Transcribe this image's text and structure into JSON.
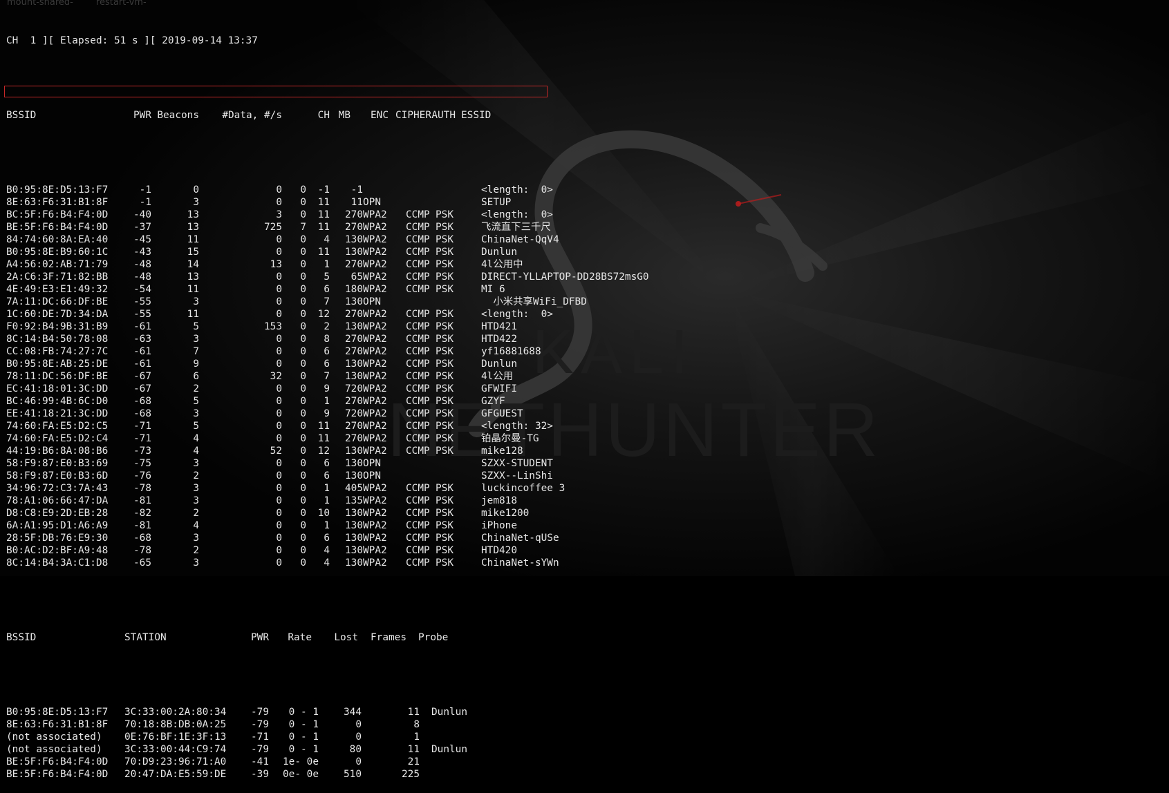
{
  "ghost_text": "mount-shared-        restart-vm-",
  "status_line": "CH  1 ][ Elapsed: 51 s ][ 2019-09-14 13:37",
  "ap_headers": [
    "BSSID",
    "PWR",
    "Beacons",
    "#Data, #/s",
    "CH",
    "MB",
    "ENC",
    "CIPHER",
    "AUTH",
    "ESSID"
  ],
  "ap_rows": [
    [
      "B0:95:8E:D5:13:F7",
      "-1",
      "0",
      "0",
      "0",
      "-1",
      "-1",
      "",
      "",
      "",
      "<length:  0>"
    ],
    [
      "8E:63:F6:31:B1:8F",
      "-1",
      "3",
      "0",
      "0",
      "11",
      "11",
      "OPN",
      "",
      "",
      "SETUP"
    ],
    [
      "BC:5F:F6:B4:F4:0D",
      "-40",
      "13",
      "3",
      "0",
      "11",
      "270",
      "WPA2",
      "CCMP",
      "PSK",
      "<length:  0>"
    ],
    [
      "BE:5F:F6:B4:F4:0D",
      "-37",
      "13",
      "725",
      "7",
      "11",
      "270",
      "WPA2",
      "CCMP",
      "PSK",
      "飞流直下三千尺"
    ],
    [
      "84:74:60:8A:EA:40",
      "-45",
      "11",
      "0",
      "0",
      "4",
      "130",
      "WPA2",
      "CCMP",
      "PSK",
      "ChinaNet-QqV4"
    ],
    [
      "B0:95:8E:B9:60:1C",
      "-43",
      "15",
      "0",
      "0",
      "11",
      "130",
      "WPA2",
      "CCMP",
      "PSK",
      "Dunlun"
    ],
    [
      "A4:56:02:AB:71:79",
      "-48",
      "14",
      "13",
      "0",
      "1",
      "270",
      "WPA2",
      "CCMP",
      "PSK",
      "4l公用中"
    ],
    [
      "2A:C6:3F:71:82:BB",
      "-48",
      "13",
      "0",
      "0",
      "5",
      "65",
      "WPA2",
      "CCMP",
      "PSK",
      "DIRECT-YLLAPTOP-DD28BS72msG0"
    ],
    [
      "4E:49:E3:E1:49:32",
      "-54",
      "11",
      "0",
      "0",
      "6",
      "180",
      "WPA2",
      "CCMP",
      "PSK",
      "MI 6"
    ],
    [
      "7A:11:DC:66:DF:BE",
      "-55",
      "3",
      "0",
      "0",
      "7",
      "130",
      "OPN",
      "",
      "",
      "  小米共享WiFi_DFBD"
    ],
    [
      "1C:60:DE:7D:34:DA",
      "-55",
      "11",
      "0",
      "0",
      "12",
      "270",
      "WPA2",
      "CCMP",
      "PSK",
      "<length:  0>"
    ],
    [
      "F0:92:B4:9B:31:B9",
      "-61",
      "5",
      "153",
      "0",
      "2",
      "130",
      "WPA2",
      "CCMP",
      "PSK",
      "HTD421"
    ],
    [
      "8C:14:B4:50:78:08",
      "-63",
      "3",
      "0",
      "0",
      "8",
      "270",
      "WPA2",
      "CCMP",
      "PSK",
      "HTD422"
    ],
    [
      "CC:08:FB:74:27:7C",
      "-61",
      "7",
      "0",
      "0",
      "6",
      "270",
      "WPA2",
      "CCMP",
      "PSK",
      "yf16881688"
    ],
    [
      "B0:95:8E:AB:25:DE",
      "-61",
      "9",
      "0",
      "0",
      "6",
      "130",
      "WPA2",
      "CCMP",
      "PSK",
      "Dunlun"
    ],
    [
      "78:11:DC:56:DF:BE",
      "-67",
      "6",
      "32",
      "0",
      "7",
      "130",
      "WPA2",
      "CCMP",
      "PSK",
      "4l公用"
    ],
    [
      "EC:41:18:01:3C:DD",
      "-67",
      "2",
      "0",
      "0",
      "9",
      "720",
      "WPA2",
      "CCMP",
      "PSK",
      "GFWIFI"
    ],
    [
      "BC:46:99:4B:6C:D0",
      "-68",
      "5",
      "0",
      "0",
      "1",
      "270",
      "WPA2",
      "CCMP",
      "PSK",
      "GZYF"
    ],
    [
      "EE:41:18:21:3C:DD",
      "-68",
      "3",
      "0",
      "0",
      "9",
      "720",
      "WPA2",
      "CCMP",
      "PSK",
      "GFGUEST"
    ],
    [
      "74:60:FA:E5:D2:C5",
      "-71",
      "5",
      "0",
      "0",
      "11",
      "270",
      "WPA2",
      "CCMP",
      "PSK",
      "<length: 32>"
    ],
    [
      "74:60:FA:E5:D2:C4",
      "-71",
      "4",
      "0",
      "0",
      "11",
      "270",
      "WPA2",
      "CCMP",
      "PSK",
      "铂晶尔曼-TG"
    ],
    [
      "44:19:B6:8A:08:B6",
      "-73",
      "4",
      "52",
      "0",
      "12",
      "130",
      "WPA2",
      "CCMP",
      "PSK",
      "mike128"
    ],
    [
      "58:F9:87:E0:B3:69",
      "-75",
      "3",
      "0",
      "0",
      "6",
      "130",
      "OPN",
      "",
      "",
      "SZXX-STUDENT"
    ],
    [
      "58:F9:87:E0:B3:6D",
      "-76",
      "2",
      "0",
      "0",
      "6",
      "130",
      "OPN",
      "",
      "",
      "SZXX--LinShi"
    ],
    [
      "34:96:72:C3:7A:43",
      "-78",
      "3",
      "0",
      "0",
      "1",
      "405",
      "WPA2",
      "CCMP",
      "PSK",
      "luckincoffee 3"
    ],
    [
      "78:A1:06:66:47:DA",
      "-81",
      "3",
      "0",
      "0",
      "1",
      "135",
      "WPA2",
      "CCMP",
      "PSK",
      "jem818"
    ],
    [
      "D8:C8:E9:2D:EB:28",
      "-82",
      "2",
      "0",
      "0",
      "10",
      "130",
      "WPA2",
      "CCMP",
      "PSK",
      "mike1200"
    ],
    [
      "6A:A1:95:D1:A6:A9",
      "-81",
      "4",
      "0",
      "0",
      "1",
      "130",
      "WPA2",
      "CCMP",
      "PSK",
      "iPhone"
    ],
    [
      "28:5F:DB:76:E9:30",
      "-68",
      "3",
      "0",
      "0",
      "6",
      "130",
      "WPA2",
      "CCMP",
      "PSK",
      "ChinaNet-qUSe"
    ],
    [
      "B0:AC:D2:BF:A9:48",
      "-78",
      "2",
      "0",
      "0",
      "4",
      "130",
      "WPA2",
      "CCMP",
      "PSK",
      "HTD420"
    ],
    [
      "8C:14:B4:3A:C1:D8",
      "-65",
      "3",
      "0",
      "0",
      "4",
      "130",
      "WPA2",
      "CCMP",
      "PSK",
      "ChinaNet-sYWn"
    ]
  ],
  "st_headers": [
    "BSSID",
    "STATION",
    "PWR",
    "Rate",
    "Lost",
    "Frames",
    "Probe"
  ],
  "st_rows": [
    [
      "B0:95:8E:D5:13:F7",
      "3C:33:00:2A:80:34",
      "-79",
      "0 - 1",
      "344",
      "11",
      "Dunlun"
    ],
    [
      "8E:63:F6:31:B1:8F",
      "70:18:8B:DB:0A:25",
      "-79",
      "0 - 1",
      "0",
      "8",
      ""
    ],
    [
      "(not associated)",
      "0E:76:BF:1E:3F:13",
      "-71",
      "0 - 1",
      "0",
      "1",
      ""
    ],
    [
      "(not associated)",
      "3C:33:00:44:C9:74",
      "-79",
      "0 - 1",
      "80",
      "11",
      "Dunlun"
    ],
    [
      "BE:5F:F6:B4:F4:0D",
      "70:D9:23:96:71:A0",
      "-41",
      "1e- 0e",
      "0",
      "21",
      ""
    ],
    [
      "BE:5F:F6:B4:F4:0D",
      "20:47:DA:E5:59:DE",
      "-39",
      "0e- 0e",
      "510",
      "225",
      ""
    ]
  ],
  "background_watermark": [
    "KALI",
    "NETHUNTER"
  ],
  "colors": {
    "text": "#e6e6e6",
    "highlight": "#c62828",
    "background": "#000000"
  }
}
